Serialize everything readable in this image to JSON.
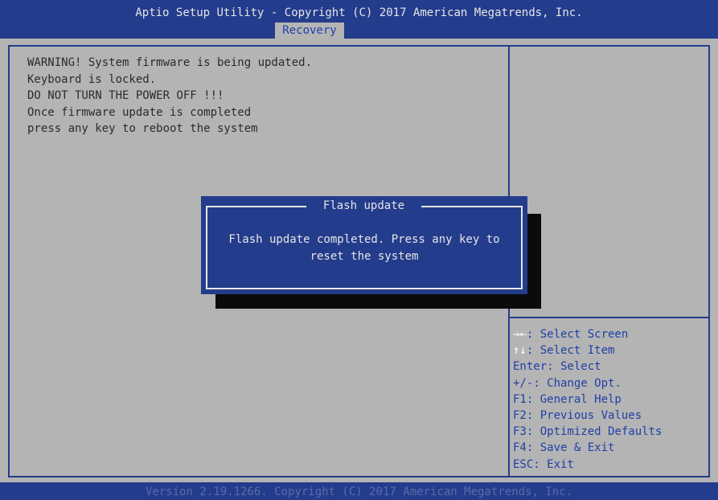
{
  "header": {
    "title": "Aptio Setup Utility - Copyright (C) 2017 American Megatrends, Inc.",
    "tab": "Recovery"
  },
  "main": {
    "warning_lines": [
      "WARNING! System firmware is being updated.",
      "Keyboard is locked.",
      "DO NOT TURN THE POWER OFF !!!",
      "Once firmware update is completed",
      "press any key to reboot the system"
    ]
  },
  "dialog": {
    "title": "Flash update",
    "message_line1": "Flash update completed. Press any key to",
    "message_line2": "reset the system"
  },
  "help": {
    "items": [
      {
        "key": "→←",
        "text": ": Select Screen"
      },
      {
        "key": "↑↓",
        "text": ": Select Item"
      },
      {
        "key": "",
        "text": "Enter: Select"
      },
      {
        "key": "",
        "text": "+/-: Change Opt."
      },
      {
        "key": "",
        "text": "F1: General Help"
      },
      {
        "key": "",
        "text": "F2: Previous Values"
      },
      {
        "key": "",
        "text": "F3: Optimized Defaults"
      },
      {
        "key": "",
        "text": "F4: Save & Exit"
      },
      {
        "key": "",
        "text": "ESC: Exit"
      }
    ]
  },
  "footer": {
    "version": "Version 2.19.1266. Copyright (C) 2017 American Megatrends, Inc."
  },
  "colors": {
    "blue": "#243c8c",
    "gray": "#b4b4b4",
    "help_text": "#1f3fa8"
  }
}
